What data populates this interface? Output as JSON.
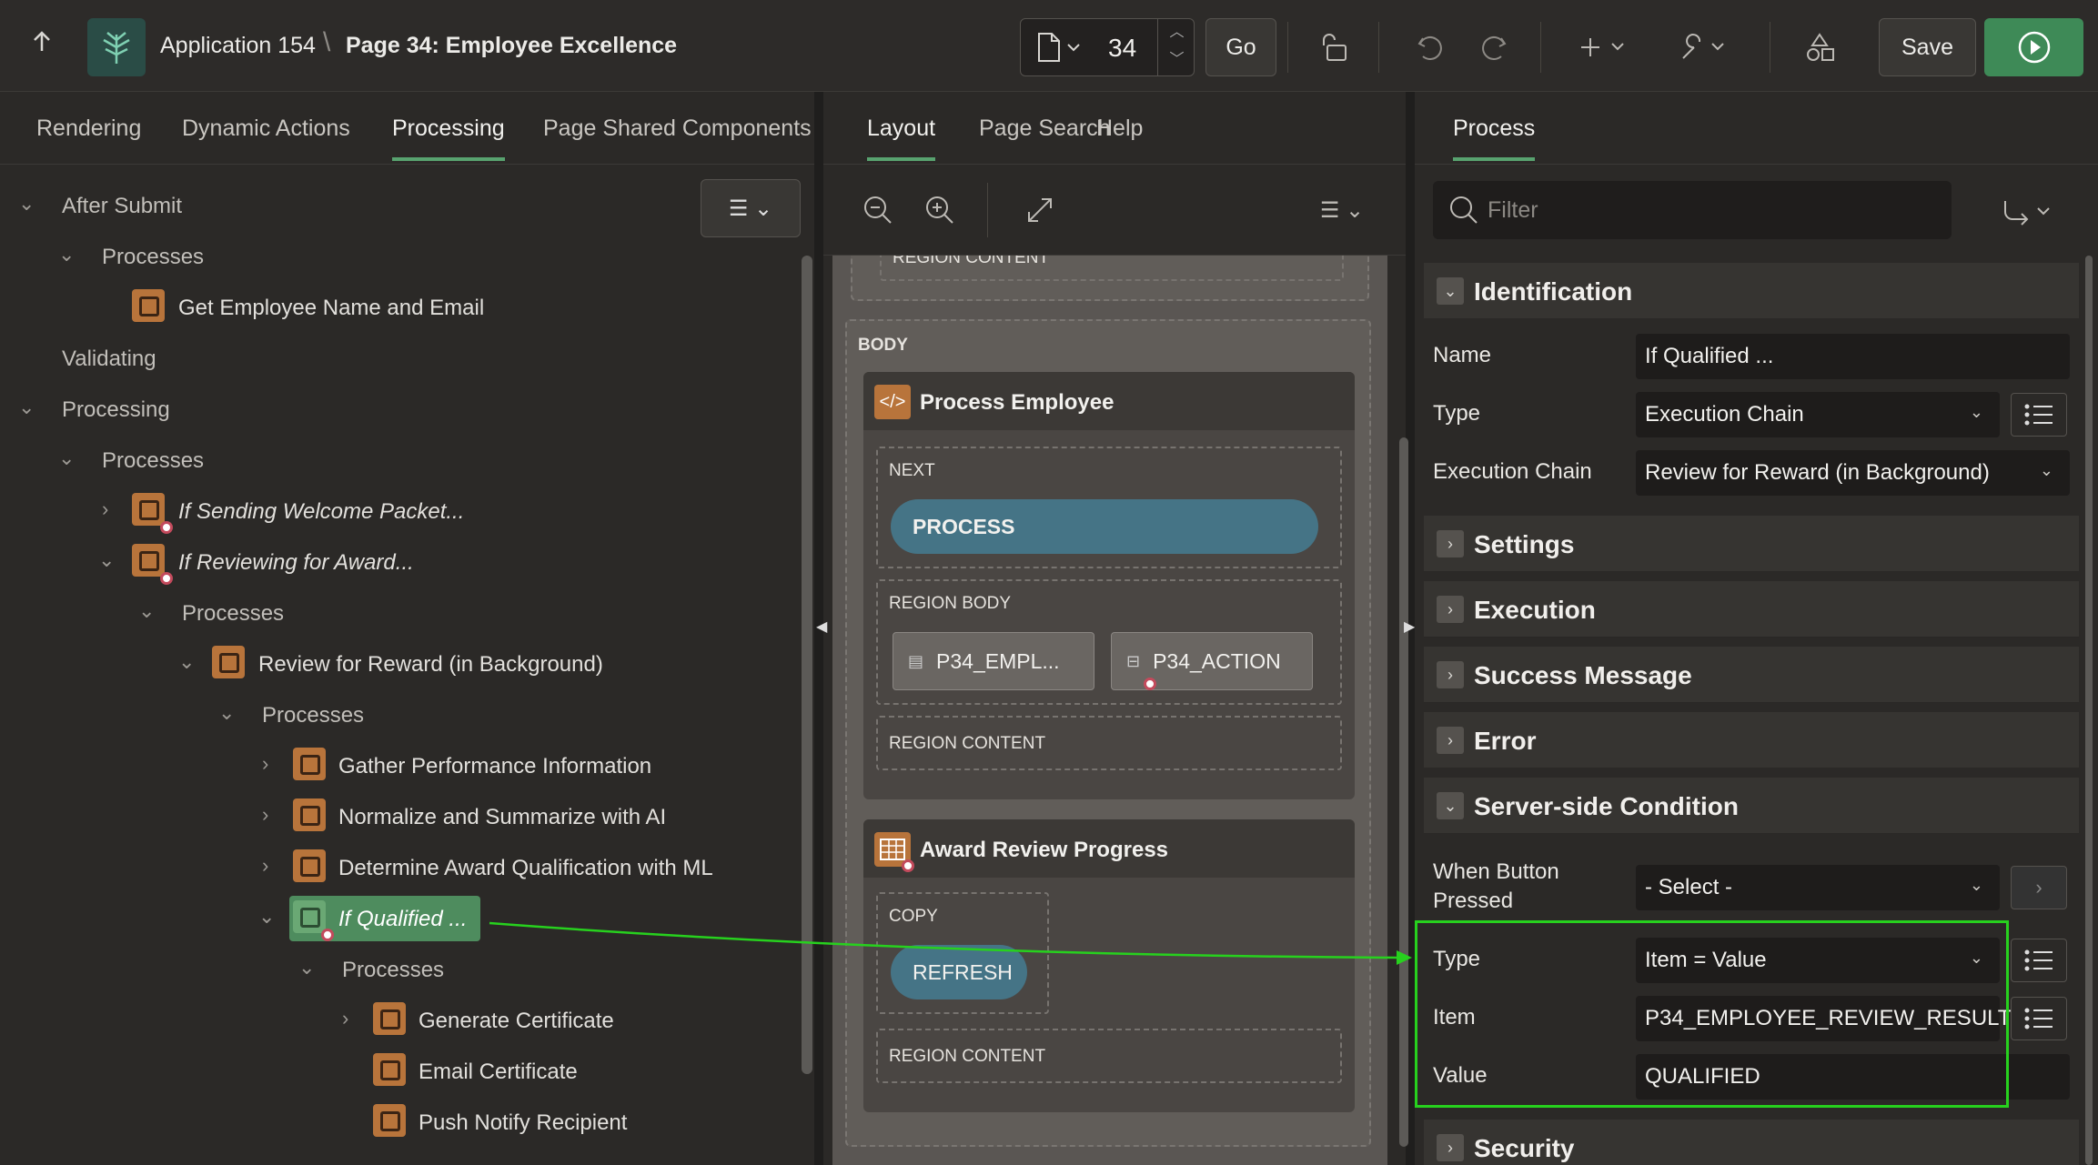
{
  "topbar": {
    "app_name": "Application 154",
    "separator": "\\",
    "page_title": "Page 34: Employee Excellence",
    "page_number": "34",
    "go_label": "Go",
    "save_label": "Save"
  },
  "left_tabs": [
    "Rendering",
    "Dynamic Actions",
    "Processing",
    "Page Shared Components"
  ],
  "left_active_tab": "Processing",
  "tree": {
    "after_submit": "After Submit",
    "processes": "Processes",
    "get_employee": "Get Employee Name and Email",
    "validating": "Validating",
    "processing": "Processing",
    "if_sending": "If Sending Welcome Packet...",
    "if_reviewing": "If Reviewing for Award...",
    "review_for_reward": "Review for Reward (in Background)",
    "gather": "Gather Performance Information",
    "normalize": "Normalize and Summarize with AI",
    "determine": "Determine Award Qualification with ML",
    "if_qualified": "If Qualified ...",
    "generate": "Generate Certificate",
    "email": "Email Certificate",
    "push": "Push Notify Recipient"
  },
  "center_tabs": [
    "Layout",
    "Page Search",
    "Help"
  ],
  "center_active_tab": "Layout",
  "layout": {
    "top_region_label": "REGION CONTENT",
    "body_label": "BODY",
    "process_employee": "Process Employee",
    "next_label": "NEXT",
    "process_button": "PROCESS",
    "region_body_label": "REGION BODY",
    "item1": "P34_EMPL...",
    "item2": "P34_ACTION",
    "region_content_label": "REGION CONTENT",
    "award_review": "Award Review Progress",
    "copy_label": "COPY",
    "refresh_button": "REFRESH",
    "region_content_label2": "REGION CONTENT"
  },
  "right_tab": "Process",
  "filter_placeholder": "Filter",
  "sections": {
    "identification": "Identification",
    "settings": "Settings",
    "execution": "Execution",
    "success_message": "Success Message",
    "error": "Error",
    "server_side_condition": "Server-side Condition",
    "security": "Security"
  },
  "props": {
    "name_label": "Name",
    "name_value": "If Qualified ...",
    "type_label": "Type",
    "type_value": "Execution Chain",
    "exec_chain_label": "Execution Chain",
    "exec_chain_value": "Review for Reward (in Background)",
    "when_button_label": "When Button Pressed",
    "when_button_value": "- Select -",
    "cond_type_label": "Type",
    "cond_type_value": "Item = Value",
    "item_label": "Item",
    "item_value": "P34_EMPLOYEE_REVIEW_RESULT",
    "value_label": "Value",
    "value_value": "QUALIFIED"
  },
  "colors": {
    "accent_green": "#3e8a57",
    "highlight_box": "#27d11e",
    "process_icon": "#b8743b"
  }
}
